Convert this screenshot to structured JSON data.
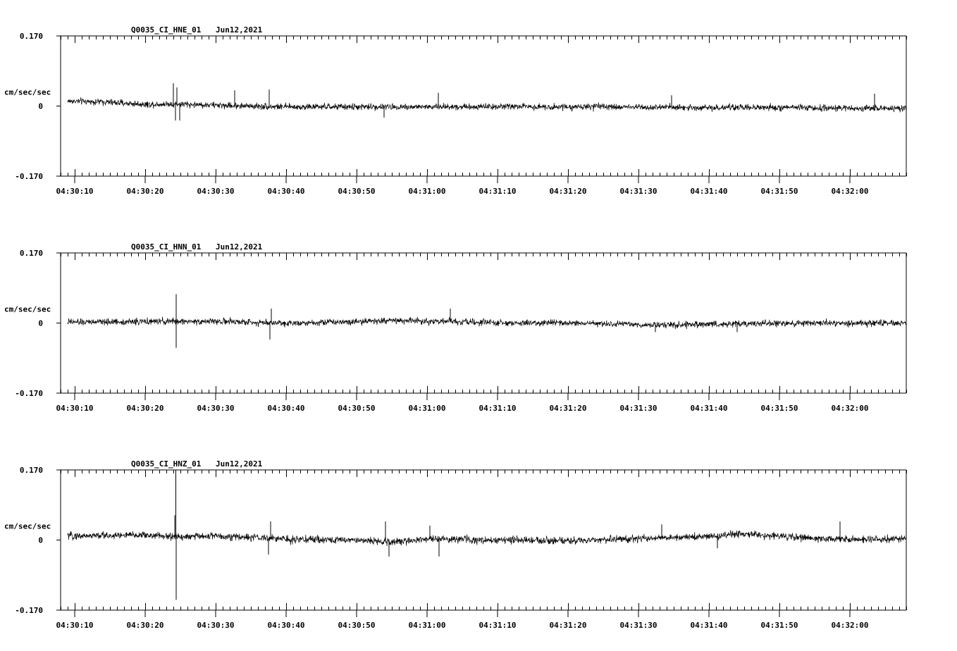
{
  "chart_data": [
    {
      "type": "line",
      "title": "Q0035_CI_HNE_01",
      "date": "Jun12,2021",
      "ylabel": "cm/sec/sec",
      "ylim": [
        -0.17,
        0.17
      ],
      "y_tick_labels": [
        "0.170",
        "0",
        "-0.170"
      ],
      "x_tick_labels": [
        "04:30:10",
        "04:30:20",
        "04:30:30",
        "04:30:40",
        "04:30:50",
        "04:31:00",
        "04:31:10",
        "04:31:20",
        "04:31:30",
        "04:31:40",
        "04:31:50",
        "04:32:00"
      ],
      "xlim_seconds": [
        8,
        128
      ],
      "signal_start_seconds": 9,
      "series": [
        {
          "noise_amplitude": 0.014,
          "envelope": [
            [
              9,
              0.012
            ],
            [
              14,
              0.01
            ],
            [
              20,
              0.004
            ],
            [
              24,
              0.005
            ],
            [
              30,
              0.002
            ],
            [
              40,
              -0.002
            ],
            [
              50,
              -0.002
            ],
            [
              60,
              -0.002
            ],
            [
              70,
              -0.001
            ],
            [
              80,
              -0.002
            ],
            [
              90,
              -0.002
            ],
            [
              100,
              -0.004
            ],
            [
              110,
              -0.004
            ],
            [
              120,
              -0.005
            ],
            [
              128,
              -0.006
            ]
          ],
          "spikes": [
            [
              24.0,
              0.055
            ],
            [
              24.3,
              -0.035
            ],
            [
              24.5,
              0.045
            ],
            [
              24.9,
              -0.035
            ],
            [
              32.7,
              0.038
            ],
            [
              37.6,
              0.04
            ],
            [
              53.9,
              -0.028
            ],
            [
              61.6,
              0.032
            ],
            [
              94.7,
              0.026
            ],
            [
              123.5,
              0.03
            ]
          ]
        }
      ]
    },
    {
      "type": "line",
      "title": "Q0035_CI_HNN_01",
      "date": "Jun12,2021",
      "ylabel": "cm/sec/sec",
      "ylim": [
        -0.17,
        0.17
      ],
      "y_tick_labels": [
        "0.170",
        "0",
        "-0.170"
      ],
      "x_tick_labels": [
        "04:30:10",
        "04:30:20",
        "04:30:30",
        "04:30:40",
        "04:30:50",
        "04:31:00",
        "04:31:10",
        "04:31:20",
        "04:31:30",
        "04:31:40",
        "04:31:50",
        "04:32:00"
      ],
      "xlim_seconds": [
        8,
        128
      ],
      "signal_start_seconds": 9,
      "series": [
        {
          "noise_amplitude": 0.014,
          "envelope": [
            [
              9,
              0.002
            ],
            [
              24,
              0.004
            ],
            [
              30,
              0.004
            ],
            [
              40,
              0.0
            ],
            [
              50,
              0.004
            ],
            [
              56,
              0.006
            ],
            [
              62,
              0.004
            ],
            [
              70,
              0.0
            ],
            [
              80,
              0.0
            ],
            [
              90,
              -0.004
            ],
            [
              95,
              -0.005
            ],
            [
              105,
              -0.002
            ],
            [
              115,
              0.0
            ],
            [
              128,
              0.0
            ]
          ],
          "spikes": [
            [
              24.4,
              0.07
            ],
            [
              24.4,
              -0.06
            ],
            [
              37.7,
              -0.04
            ],
            [
              37.9,
              0.035
            ],
            [
              63.3,
              0.035
            ],
            [
              92.4,
              -0.022
            ],
            [
              104.0,
              -0.022
            ]
          ]
        }
      ]
    },
    {
      "type": "line",
      "title": "Q0035_CI_HNZ_01",
      "date": "Jun12,2021",
      "ylabel": "cm/sec/sec",
      "ylim": [
        -0.17,
        0.17
      ],
      "y_tick_labels": [
        "0.170",
        "0",
        "-0.170"
      ],
      "x_tick_labels": [
        "04:30:10",
        "04:30:20",
        "04:30:30",
        "04:30:40",
        "04:30:50",
        "04:31:00",
        "04:31:10",
        "04:31:20",
        "04:31:30",
        "04:31:40",
        "04:31:50",
        "04:32:00"
      ],
      "xlim_seconds": [
        8,
        128
      ],
      "signal_start_seconds": 9,
      "series": [
        {
          "noise_amplitude": 0.016,
          "envelope": [
            [
              9,
              0.01
            ],
            [
              20,
              0.012
            ],
            [
              24,
              0.008
            ],
            [
              30,
              0.01
            ],
            [
              40,
              0.002
            ],
            [
              50,
              0.0
            ],
            [
              55,
              -0.005
            ],
            [
              60,
              0.003
            ],
            [
              70,
              0.0
            ],
            [
              80,
              -0.003
            ],
            [
              90,
              0.004
            ],
            [
              100,
              0.008
            ],
            [
              104,
              0.014
            ],
            [
              110,
              0.01
            ],
            [
              120,
              0.0
            ],
            [
              128,
              0.004
            ]
          ],
          "spikes": [
            [
              24.35,
              0.17
            ],
            [
              24.4,
              -0.145
            ],
            [
              24.2,
              0.06
            ],
            [
              37.5,
              -0.035
            ],
            [
              37.8,
              0.045
            ],
            [
              54.1,
              0.045
            ],
            [
              54.6,
              -0.04
            ],
            [
              60.4,
              0.035
            ],
            [
              61.7,
              -0.04
            ],
            [
              93.3,
              0.038
            ],
            [
              101.2,
              -0.02
            ],
            [
              118.6,
              0.045
            ]
          ]
        }
      ]
    }
  ]
}
